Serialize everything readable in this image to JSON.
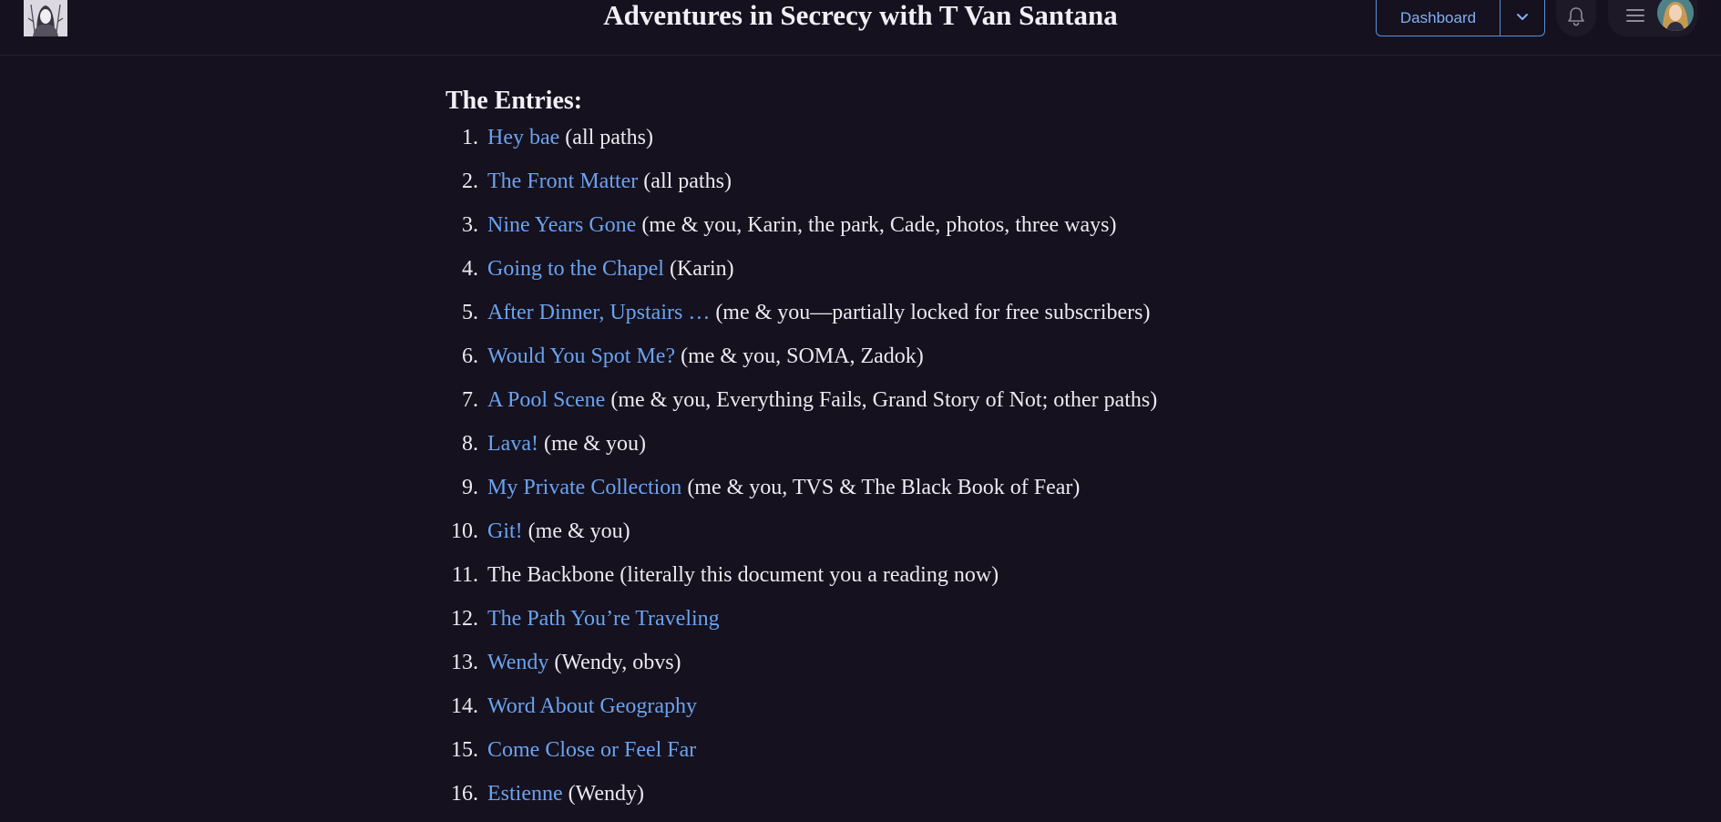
{
  "header": {
    "title": "Adventures in Secrecy with T Van Santana",
    "dashboard_label": "Dashboard",
    "icons": {
      "logo": "portrait-logo",
      "dropdown": "chevron-down-icon",
      "notifications": "bell-icon",
      "menu": "hamburger-menu-icon",
      "avatar": "user-avatar"
    }
  },
  "main": {
    "heading": "The Entries:",
    "entries": [
      {
        "num": "1.",
        "title": "Hey bae",
        "note": " (all paths)",
        "linked": true
      },
      {
        "num": "2.",
        "title": "The Front Matter",
        "note": " (all paths)",
        "linked": true
      },
      {
        "num": "3.",
        "title": "Nine Years Gone",
        "note": " (me & you, Karin, the park, Cade, photos, three ways)",
        "linked": true
      },
      {
        "num": "4.",
        "title": "Going to the Chapel",
        "note": " (Karin)",
        "linked": true
      },
      {
        "num": "5.",
        "title": "After Dinner, Upstairs …",
        "note": " (me & you—partially locked for free subscribers)",
        "linked": true
      },
      {
        "num": "6.",
        "title": "Would You Spot Me?",
        "note": " (me & you, SOMA, Zadok)",
        "linked": true
      },
      {
        "num": "7.",
        "title": "A Pool Scene",
        "note": " (me & you, Everything Fails, Grand Story of Not; other paths)",
        "linked": true
      },
      {
        "num": "8.",
        "title": "Lava!",
        "note": " (me & you)",
        "linked": true
      },
      {
        "num": "9.",
        "title": "My Private Collection",
        "note": " (me & you, TVS & The Black Book of Fear)",
        "linked": true
      },
      {
        "num": "10.",
        "title": "Git!",
        "note": " (me & you)",
        "linked": true
      },
      {
        "num": "11.",
        "title": "The Backbone",
        "note": " (literally this document you a reading now)",
        "linked": false
      },
      {
        "num": "12.",
        "title": "The Path You’re Traveling",
        "note": "",
        "linked": true
      },
      {
        "num": "13.",
        "title": "Wendy",
        "note": " (Wendy, obvs)",
        "linked": true
      },
      {
        "num": "14.",
        "title": "Word About Geography",
        "note": "",
        "linked": true
      },
      {
        "num": "15.",
        "title": "Come Close or Feel Far",
        "note": "",
        "linked": true
      },
      {
        "num": "16.",
        "title": "Estienne",
        "note": " (Wendy)",
        "linked": true
      }
    ]
  },
  "colors": {
    "background": "#15111e",
    "link": "#6aa3f0",
    "text": "#ece9f2",
    "accent_border": "#5b8fd9"
  }
}
